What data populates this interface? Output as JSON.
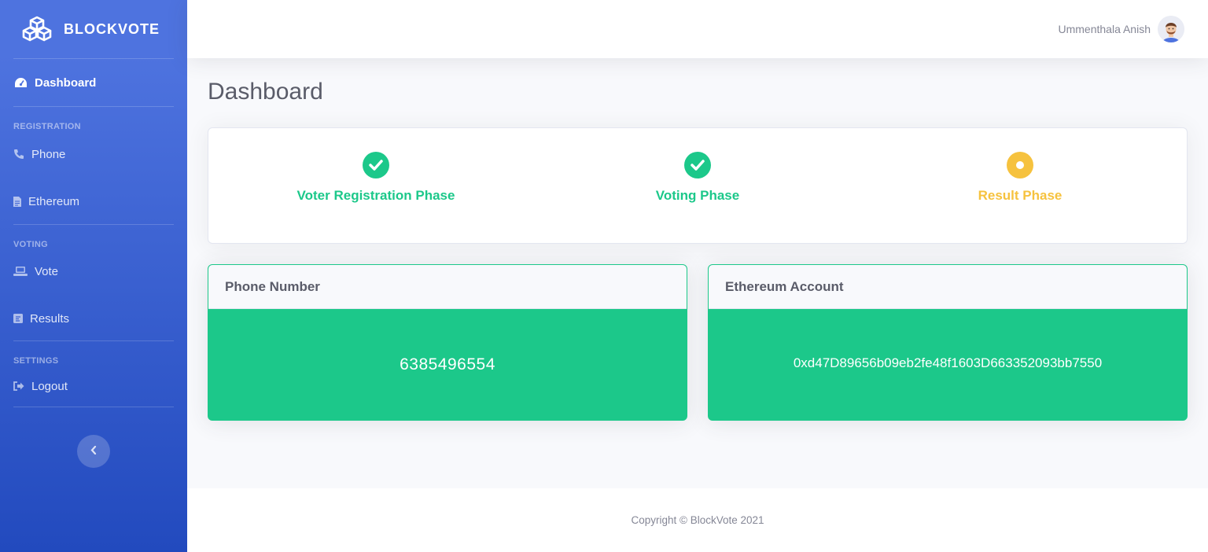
{
  "brand": {
    "name": "BLOCKVOTE",
    "icon": "cubes-icon"
  },
  "sidebar": {
    "dashboard": {
      "label": "Dashboard",
      "icon": "tachometer-icon"
    },
    "sections": {
      "registration": "REGISTRATION",
      "voting": "VOTING",
      "settings": "SETTINGS"
    },
    "items": {
      "phone": {
        "label": "Phone",
        "icon": "phone-icon"
      },
      "ethereum": {
        "label": "Ethereum",
        "icon": "file-icon"
      },
      "vote": {
        "label": "Vote",
        "icon": "laptop-icon"
      },
      "results": {
        "label": "Results",
        "icon": "poll-icon"
      },
      "logout": {
        "label": "Logout",
        "icon": "sign-out-icon"
      }
    },
    "toggle_icon": "chevron-left-icon"
  },
  "topbar": {
    "user_name": "Ummenthala Anish"
  },
  "main": {
    "title": "Dashboard",
    "phases": [
      {
        "label": "Voter Registration Phase",
        "status": "complete",
        "color": "#1cc88a"
      },
      {
        "label": "Voting Phase",
        "status": "complete",
        "color": "#1cc88a"
      },
      {
        "label": "Result Phase",
        "status": "current",
        "color": "#f6c23e"
      }
    ],
    "phone_card": {
      "title": "Phone Number",
      "value": "6385496554"
    },
    "eth_card": {
      "title": "Ethereum Account",
      "value": "0xd47D89656b09eb2fe48f1603D663352093bb7550"
    }
  },
  "footer": {
    "text": "Copyright © BlockVote 2021"
  },
  "colors": {
    "primary": "#4e73df",
    "success": "#1cc88a",
    "warning": "#f6c23e"
  }
}
